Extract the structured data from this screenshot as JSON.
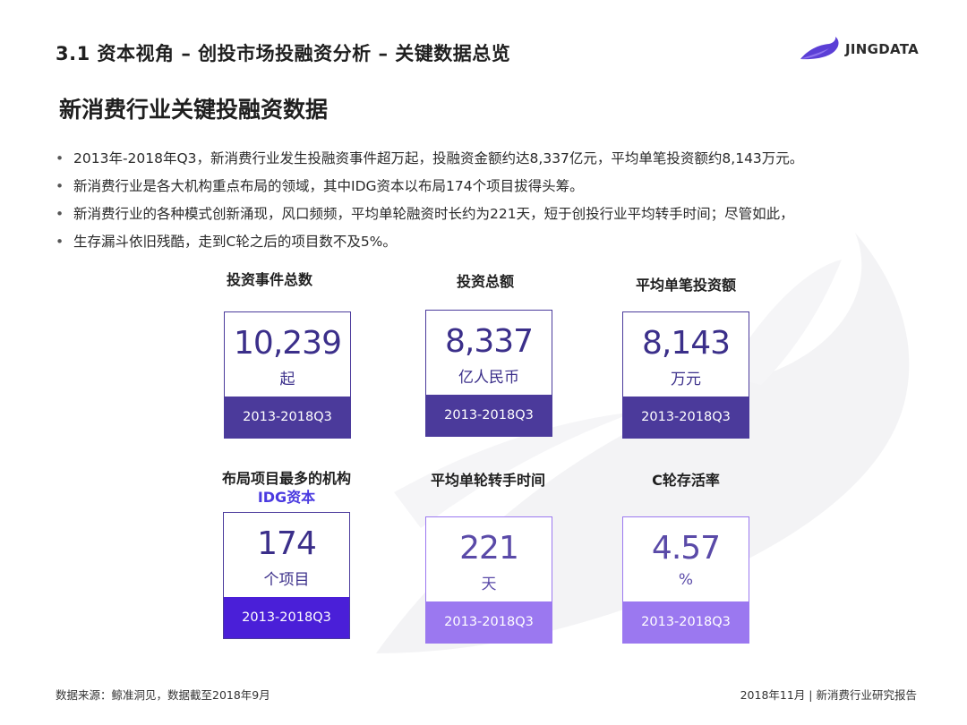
{
  "header": {
    "section_title": "3.1 资本视角 – 创投市场投融资分析 – 关键数据总览",
    "logo_text": "JINGDATA"
  },
  "slide_title": "新消费行业关键投融资数据",
  "bullets": [
    "2013年-2018年Q3，新消费行业发生投融资事件超万起，投融资金额约达8,337亿元，平均单笔投资额约8,143万元。",
    "新消费行业是各大机构重点布局的领域，其中IDG资本以布局174个项目拔得头筹。",
    "新消费行业的各种模式创新涌现，风口频频，平均单轮融资时长约为221天，短于创投行业平均转手时间；尽管如此，",
    "生存漏斗依旧残酷，走到C轮之后的项目数不及5%。"
  ],
  "metrics": [
    {
      "label": "投资事件总数",
      "value": "10,239",
      "unit": "起",
      "period": "2013-2018Q3"
    },
    {
      "label": "投资总额",
      "value": "8,337",
      "unit": "亿人民币",
      "period": "2013-2018Q3"
    },
    {
      "label": "平均单笔投资额",
      "value": "8,143",
      "unit": "万元",
      "period": "2013-2018Q3"
    },
    {
      "label": "布局项目最多的机构",
      "sublabel": "IDG资本",
      "value": "174",
      "unit": "个项目",
      "period": "2013-2018Q3"
    },
    {
      "label": "平均单轮转手时间",
      "value": "221",
      "unit": "天",
      "period": "2013-2018Q3"
    },
    {
      "label": "C轮存活率",
      "value": "4.57",
      "unit": "%",
      "period": "2013-2018Q3"
    }
  ],
  "footer": {
    "source": "数据来源：鲸准洞见，数据截至2018年9月",
    "report": "2018年11月 | 新消费行业研究报告"
  },
  "colors": {
    "dark_purple": "#4b3a9b",
    "bright_purple": "#4a1fd8",
    "light_purple": "#9b78f0",
    "value_text": "#3b2f8a"
  },
  "icons": [
    "whale-logo-icon",
    "whale-watermark-icon"
  ]
}
